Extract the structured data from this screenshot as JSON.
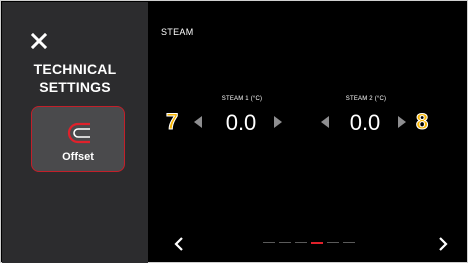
{
  "sidebar": {
    "title_line1": "TECHNICAL",
    "title_line2": "SETTINGS",
    "close_icon": "close-icon",
    "offset_button": {
      "label": "Offset",
      "icon": "offset-icon"
    }
  },
  "content": {
    "title": "STEAM",
    "fields": [
      {
        "label": "STEAM 1 (°C)",
        "value": "0.0",
        "callout": "7"
      },
      {
        "label": "STEAM 2 (°C)",
        "value": "0.0",
        "callout": "8"
      }
    ]
  },
  "pagination": {
    "pages": 6,
    "current_page": 4
  },
  "colors": {
    "accent": "#e0212b",
    "callout": "#f5b400",
    "sidebar_bg": "#2c2c2e",
    "button_bg": "#4a4a4c"
  }
}
